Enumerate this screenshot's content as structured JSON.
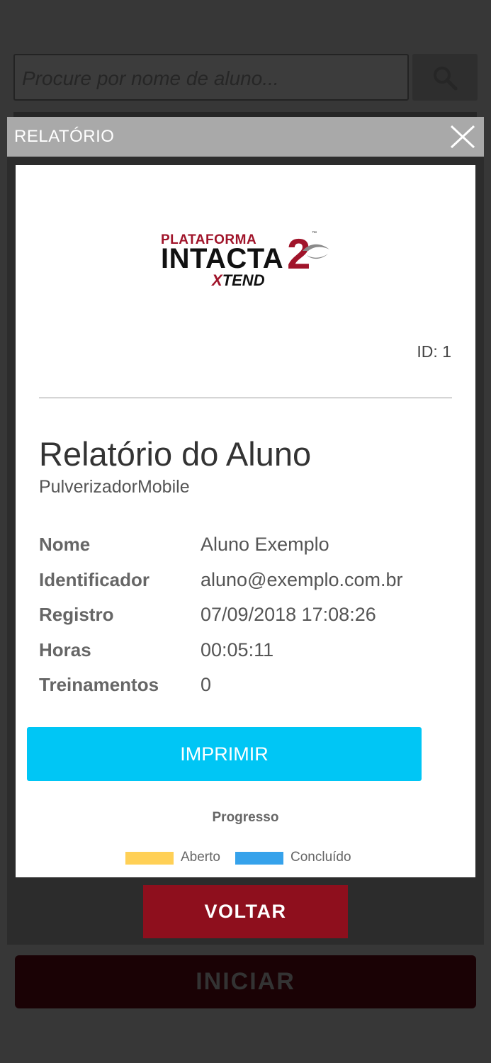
{
  "background": {
    "search": {
      "placeholder": "Procure por nome de aluno..."
    },
    "start_button_label": "INICIAR"
  },
  "modal": {
    "title": "RELATÓRIO",
    "report": {
      "logo": {
        "top": "PLATAFORMA",
        "main": "INTACTA",
        "number": "2",
        "tm": "™",
        "sub_prefix": "X",
        "sub": "TEND"
      },
      "id_text": "ID: 1",
      "title": "Relatório do Aluno",
      "subtitle": "PulverizadorMobile",
      "fields": [
        {
          "label": "Nome",
          "value": "Aluno Exemplo"
        },
        {
          "label": "Identificador",
          "value": "aluno@exemplo.com.br"
        },
        {
          "label": "Registro",
          "value": "07/09/2018 17:08:26"
        },
        {
          "label": "Horas",
          "value": "00:05:11"
        },
        {
          "label": "Treinamentos",
          "value": "0"
        }
      ],
      "print_button_label": "IMPRIMIR",
      "progress_title": "Progresso",
      "legend": [
        {
          "label": "Aberto",
          "color": "#ffd056"
        },
        {
          "label": "Concluído",
          "color": "#36a2eb"
        }
      ]
    },
    "back_button_label": "VOLTAR"
  },
  "colors": {
    "accent_blue": "#00c6f5",
    "brand_red": "#8e0f1d"
  }
}
